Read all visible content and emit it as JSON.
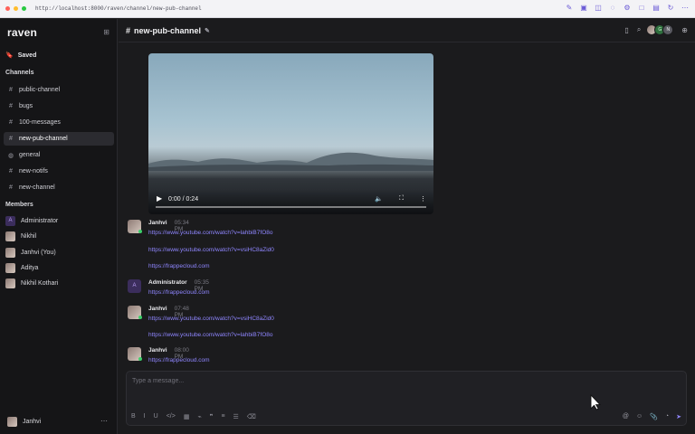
{
  "browser": {
    "url": "http://localhost:8000/raven/channel/new-pub-channel"
  },
  "sidebar": {
    "brand": "raven",
    "saved_label": "Saved",
    "channels_title": "Channels",
    "channels": [
      {
        "name": "public-channel",
        "icon": "hash-icon"
      },
      {
        "name": "bugs",
        "icon": "hash-icon"
      },
      {
        "name": "100-messages",
        "icon": "hash-icon"
      },
      {
        "name": "new-pub-channel",
        "icon": "hash-icon",
        "active": true
      },
      {
        "name": "general",
        "icon": "globe-icon"
      },
      {
        "name": "new-notifs",
        "icon": "hash-icon"
      },
      {
        "name": "new-channel",
        "icon": "hash-icon"
      }
    ],
    "members_title": "Members",
    "members": [
      {
        "name": "Administrator",
        "initial": "A"
      },
      {
        "name": "Nikhil"
      },
      {
        "name": "Janhvi (You)"
      },
      {
        "name": "Aditya"
      },
      {
        "name": "Nikhil Kothari"
      }
    ],
    "current_user": "Janhvi",
    "more_icon": "ellipsis-icon"
  },
  "header": {
    "channel": "new-pub-channel",
    "avatars": [
      "",
      "G",
      "N"
    ]
  },
  "video": {
    "time": "0:00 / 0:24"
  },
  "messages": [
    {
      "author": "Janhvi",
      "time": "05:34 PM",
      "avatar": "photo",
      "links": [
        "https://www.youtube.com/watch?v=lahbiB7fO8o",
        "https://www.youtube.com/watch?v=vsiHC8aZid0",
        "https://frappecloud.com"
      ]
    },
    {
      "author": "Administrator",
      "time": "05:35 PM",
      "avatar": "A",
      "links": [
        "https://frappecloud.com"
      ]
    },
    {
      "author": "Janhvi",
      "time": "07:48 PM",
      "avatar": "photo",
      "links": [
        "https://www.youtube.com/watch?v=vsiHC8aZid0",
        "https://www.youtube.com/watch?v=lahbiB7fO8o"
      ]
    },
    {
      "author": "Janhvi",
      "time": "08:00 PM",
      "avatar": "photo",
      "links": [
        "https://frappecloud.com"
      ]
    }
  ],
  "composer": {
    "placeholder": "Type a message..."
  }
}
